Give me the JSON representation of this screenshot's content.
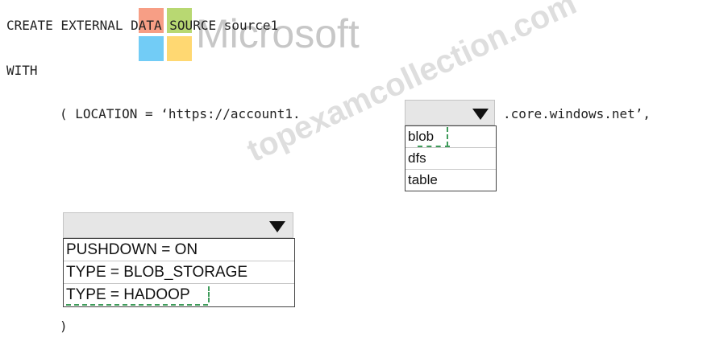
{
  "code": {
    "line1": "CREATE EXTERNAL DATA SOURCE source1",
    "line2": "WITH",
    "line3_prefix": "( LOCATION = ‘https://account1.",
    "line3_suffix": ".core.windows.net’,",
    "closing": ")"
  },
  "watermark": {
    "brand_text": "Microsoft",
    "site_text": "topexamcollection.com"
  },
  "dropdowns": {
    "storage_endpoint": {
      "options": [
        "blob",
        "dfs",
        "table"
      ]
    },
    "connection_option": {
      "options": [
        "PUSHDOWN = ON",
        "TYPE = BLOB_STORAGE",
        "TYPE = HADOOP"
      ]
    }
  },
  "colors": {
    "dropdown_header": "#e6e6e6",
    "answer_highlight": "#3e9b5a",
    "text": "#222222"
  }
}
